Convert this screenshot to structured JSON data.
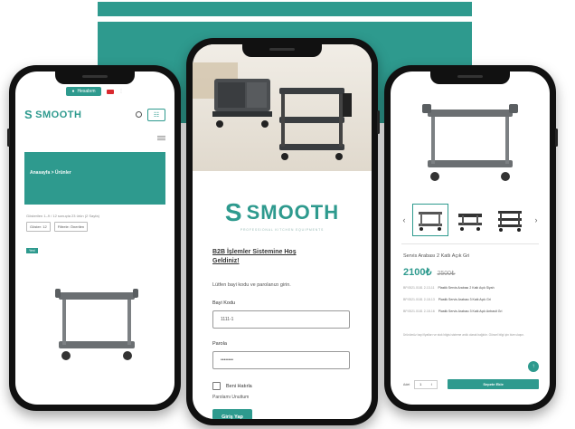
{
  "colors": {
    "brand": "#2e9a8e",
    "phone_frame": "#111111"
  },
  "left_phone": {
    "login_label": "Hesabım",
    "brand": "SMOOTH",
    "breadcrumb": "Anasayfa > Ürünler",
    "results_text": "Gösterilen 1–9 / 12 sonuçta 23 ürün (2 Sayfa)",
    "filter_count": "Göster: 12",
    "filter_sort": "Filtrele: Önerilen",
    "badge": "Yeni",
    "icons": [
      "user-icon",
      "flag-icon",
      "search-icon",
      "cart-icon",
      "menu-icon"
    ]
  },
  "center_phone": {
    "brand": "SMOOTH",
    "tagline": "PROFESSIONAL KITCHEN EQUIPMENTS",
    "welcome_title": "B2B İşlemler Sistemine Hoş Geldiniz!",
    "subtitle": "Lütfen bayi kodu ve parolanızı girin.",
    "dealer_code_label": "Bayi Kodu",
    "dealer_code_value": "1111-1",
    "password_label": "Parola",
    "password_value": "••••••••",
    "remember_label": "Beni Hatırla",
    "forgot_label": "Parolamı Unuttum",
    "login_button": "Giriş Yap"
  },
  "right_phone": {
    "product_title": "Servis Arabası 2 Katlı Açık Gri",
    "price": "2100₺",
    "old_price": "2500₺",
    "variants": [
      {
        "code": "BP.0521.0181 2-13-11",
        "name": "Plastik Servis Arabası 2 Katlı Açık Siyah"
      },
      {
        "code": "BP.0521.0181 2-18-13",
        "name": "Plastik Servis Arabası 3 Katlı Açık Gri"
      },
      {
        "code": "BP.0521.0181 2-18-16",
        "name": "Plastik Servis Arabası 3 Katlı Açık Antrasit Gri"
      }
    ],
    "note": "Ürünümüz bayi fiyatları ve stok bilgisi sisteme anlık olarak bağlıdır. Güncel bilgi için bize ulaşın.",
    "qty_label": "Adet",
    "qty_value": "1",
    "add_button": "Sepete Ekle",
    "arrow_left": "‹",
    "arrow_right": "›"
  }
}
